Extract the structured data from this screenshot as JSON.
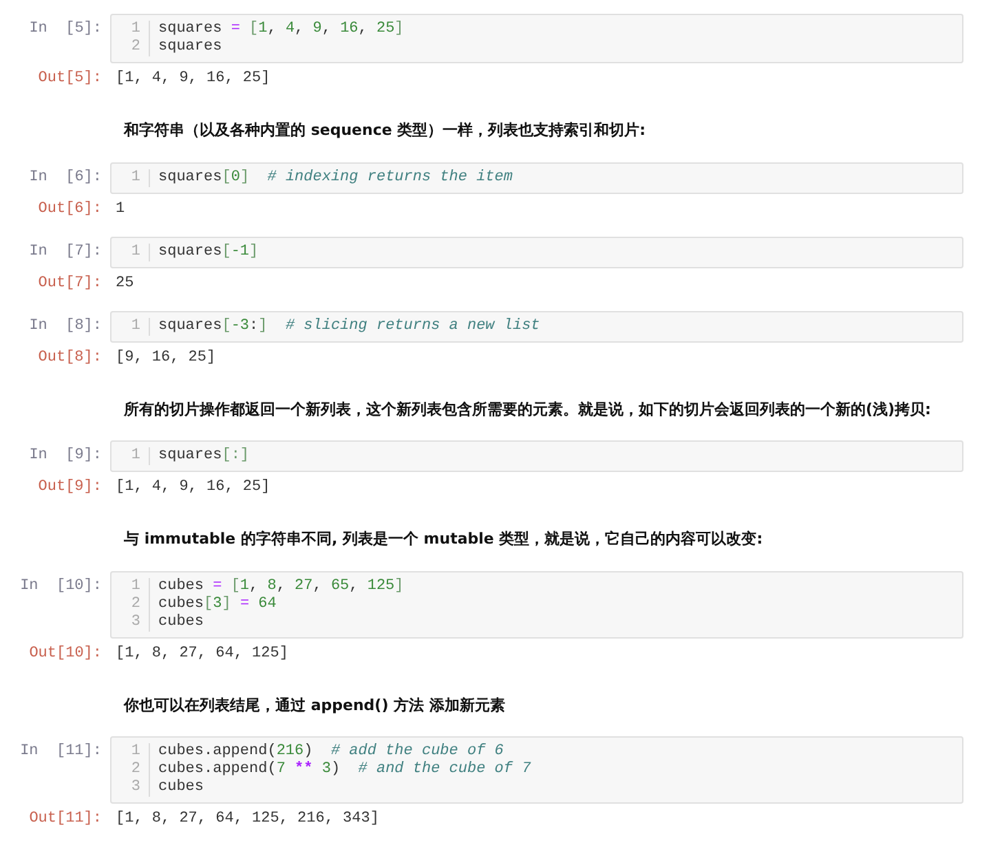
{
  "cells": [
    {
      "kind": "code",
      "prompt": "In  [5]:",
      "lines": [
        {
          "number": "1",
          "tokens": [
            {
              "kind": "text",
              "text": "squares "
            },
            {
              "kind": "op",
              "text": "="
            },
            {
              "kind": "punct",
              "text": " ["
            },
            {
              "kind": "num",
              "text": "1"
            },
            {
              "kind": "text",
              "text": ", "
            },
            {
              "kind": "num",
              "text": "4"
            },
            {
              "kind": "text",
              "text": ", "
            },
            {
              "kind": "num",
              "text": "9"
            },
            {
              "kind": "text",
              "text": ", "
            },
            {
              "kind": "num",
              "text": "16"
            },
            {
              "kind": "text",
              "text": ", "
            },
            {
              "kind": "num",
              "text": "25"
            },
            {
              "kind": "punct",
              "text": "]"
            }
          ]
        },
        {
          "number": "2",
          "tokens": [
            {
              "kind": "text",
              "text": "squares"
            }
          ]
        }
      ],
      "output": {
        "prompt": "Out[5]:",
        "text": "[1, 4, 9, 16, 25]"
      }
    },
    {
      "kind": "markdown",
      "text": "和字符串（以及各种内置的 sequence 类型）一样，列表也支持索引和切片:"
    },
    {
      "kind": "code",
      "prompt": "In  [6]:",
      "lines": [
        {
          "number": "1",
          "tokens": [
            {
              "kind": "text",
              "text": "squares"
            },
            {
              "kind": "punct",
              "text": "["
            },
            {
              "kind": "num",
              "text": "0"
            },
            {
              "kind": "punct",
              "text": "]"
            },
            {
              "kind": "comment",
              "text": "  # indexing returns the item"
            }
          ]
        }
      ],
      "output": {
        "prompt": "Out[6]:",
        "text": "1"
      }
    },
    {
      "kind": "code",
      "prompt": "In  [7]:",
      "lines": [
        {
          "number": "1",
          "tokens": [
            {
              "kind": "text",
              "text": "squares"
            },
            {
              "kind": "punct",
              "text": "["
            },
            {
              "kind": "num",
              "text": "-1"
            },
            {
              "kind": "punct",
              "text": "]"
            }
          ]
        }
      ],
      "output": {
        "prompt": "Out[7]:",
        "text": "25"
      }
    },
    {
      "kind": "code",
      "prompt": "In  [8]:",
      "lines": [
        {
          "number": "1",
          "tokens": [
            {
              "kind": "text",
              "text": "squares"
            },
            {
              "kind": "punct",
              "text": "["
            },
            {
              "kind": "num",
              "text": "-3"
            },
            {
              "kind": "text",
              "text": ":"
            },
            {
              "kind": "punct",
              "text": "]"
            },
            {
              "kind": "comment",
              "text": "  # slicing returns a new list"
            }
          ]
        }
      ],
      "output": {
        "prompt": "Out[8]:",
        "text": "[9, 16, 25]"
      }
    },
    {
      "kind": "markdown",
      "text": "所有的切片操作都返回一个新列表，这个新列表包含所需要的元素。就是说，如下的切片会返回列表的一个新的(浅)拷贝:"
    },
    {
      "kind": "code",
      "prompt": "In  [9]:",
      "lines": [
        {
          "number": "1",
          "tokens": [
            {
              "kind": "text",
              "text": "squares"
            },
            {
              "kind": "punct",
              "text": "[:]"
            }
          ]
        }
      ],
      "output": {
        "prompt": "Out[9]:",
        "text": "[1, 4, 9, 16, 25]"
      }
    },
    {
      "kind": "markdown",
      "text": "与 immutable 的字符串不同, 列表是一个 mutable 类型，就是说，它自己的内容可以改变:"
    },
    {
      "kind": "code",
      "prompt": "In  [10]:",
      "lines": [
        {
          "number": "1",
          "tokens": [
            {
              "kind": "text",
              "text": "cubes "
            },
            {
              "kind": "op",
              "text": "="
            },
            {
              "kind": "punct",
              "text": " ["
            },
            {
              "kind": "num",
              "text": "1"
            },
            {
              "kind": "text",
              "text": ", "
            },
            {
              "kind": "num",
              "text": "8"
            },
            {
              "kind": "text",
              "text": ", "
            },
            {
              "kind": "num",
              "text": "27"
            },
            {
              "kind": "text",
              "text": ", "
            },
            {
              "kind": "num",
              "text": "65"
            },
            {
              "kind": "text",
              "text": ", "
            },
            {
              "kind": "num",
              "text": "125"
            },
            {
              "kind": "punct",
              "text": "]"
            }
          ]
        },
        {
          "number": "2",
          "tokens": [
            {
              "kind": "text",
              "text": "cubes"
            },
            {
              "kind": "punct",
              "text": "["
            },
            {
              "kind": "num",
              "text": "3"
            },
            {
              "kind": "punct",
              "text": "] "
            },
            {
              "kind": "op",
              "text": "= "
            },
            {
              "kind": "num",
              "text": "64"
            }
          ]
        },
        {
          "number": "3",
          "tokens": [
            {
              "kind": "text",
              "text": "cubes"
            }
          ]
        }
      ],
      "output": {
        "prompt": "Out[10]:",
        "text": "[1, 8, 27, 64, 125]"
      }
    },
    {
      "kind": "markdown",
      "text": "你也可以在列表结尾，通过 append() 方法 添加新元素"
    },
    {
      "kind": "code",
      "prompt": "In  [11]:",
      "lines": [
        {
          "number": "1",
          "tokens": [
            {
              "kind": "text",
              "text": "cubes.append("
            },
            {
              "kind": "num",
              "text": "216"
            },
            {
              "kind": "text",
              "text": ")"
            },
            {
              "kind": "comment",
              "text": "  # add the cube of 6"
            }
          ]
        },
        {
          "number": "2",
          "tokens": [
            {
              "kind": "text",
              "text": "cubes.append("
            },
            {
              "kind": "num",
              "text": "7 "
            },
            {
              "kind": "kw",
              "text": "** "
            },
            {
              "kind": "num",
              "text": "3"
            },
            {
              "kind": "text",
              "text": ")"
            },
            {
              "kind": "comment",
              "text": "  # and the cube of 7"
            }
          ]
        },
        {
          "number": "3",
          "tokens": [
            {
              "kind": "text",
              "text": "cubes"
            }
          ]
        }
      ],
      "output": {
        "prompt": "Out[11]:",
        "text": "[1, 8, 27, 64, 125, 216, 343]"
      }
    }
  ]
}
